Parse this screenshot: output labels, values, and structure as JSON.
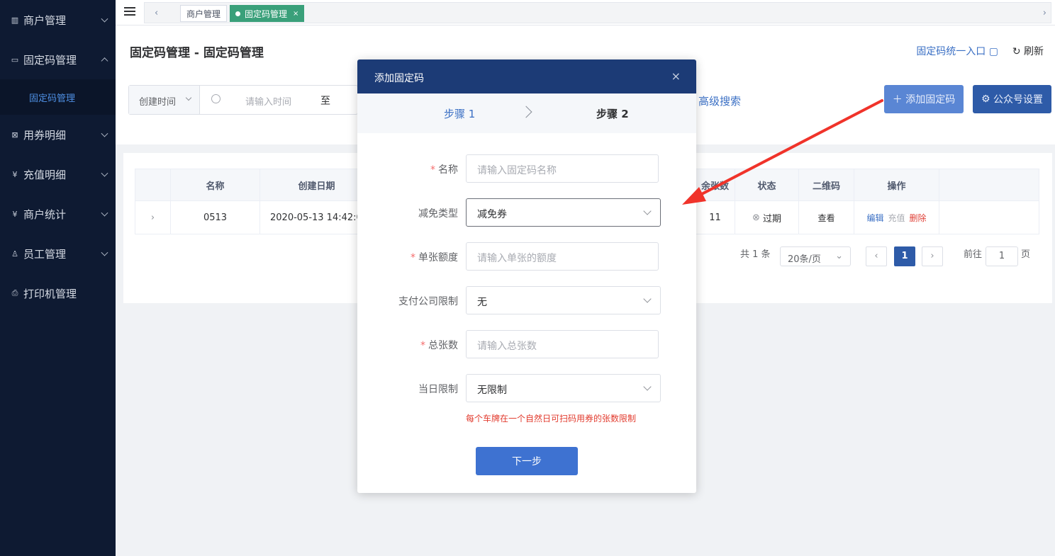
{
  "sidebar": {
    "items": [
      {
        "label": "商户管理",
        "icon": "building-icon"
      },
      {
        "label": "固定码管理",
        "icon": "card-icon"
      },
      {
        "label": "用券明细",
        "icon": "coupon-icon"
      },
      {
        "label": "充值明细",
        "icon": "yen-icon"
      },
      {
        "label": "商户统计",
        "icon": "yen-icon"
      },
      {
        "label": "员工管理",
        "icon": "user-icon"
      },
      {
        "label": "打印机管理",
        "icon": "printer-icon"
      }
    ],
    "sub_item": "固定码管理"
  },
  "tabs": {
    "tab1": "商户管理",
    "tab2": "固定码管理",
    "close": "×"
  },
  "header": {
    "title": "固定码管理 - 固定码管理",
    "entry_link": "固定码统一入口",
    "refresh": "刷新"
  },
  "filter": {
    "select": "创建时间",
    "placeholder": "请输入时间",
    "to": "至",
    "advanced": "高级搜索"
  },
  "buttons": {
    "add": "添加固定码",
    "wechat": "公众号设置"
  },
  "table": {
    "headers": [
      "名称",
      "创建日期",
      "余张数",
      "状态",
      "二维码",
      "操作"
    ],
    "row": {
      "name": "0513",
      "date": "2020-05-13 14:42:0",
      "remain": "11",
      "status": "过期",
      "qr": "查看",
      "edit": "编辑",
      "recharge": "充值",
      "delete": "删除"
    }
  },
  "pager": {
    "total": "共 1 条",
    "size": "20条/页",
    "page": "1",
    "goto": "前往",
    "goto_page": "1",
    "page_unit": "页"
  },
  "dialog": {
    "title": "添加固定码",
    "close": "×",
    "step1": "步骤 1",
    "step2": "步骤 2",
    "fields": {
      "name_label": "名称",
      "name_ph": "请输入固定码名称",
      "type_label": "减免类型",
      "type_value": "减免券",
      "amount_label": "单张额度",
      "amount_ph": "请输入单张的额度",
      "pay_label": "支付公司限制",
      "pay_value": "无",
      "total_label": "总张数",
      "total_ph": "请输入总张数",
      "daily_label": "当日限制",
      "daily_value": "无限制"
    },
    "hint": "每个车牌在一个自然日可扫码用券的张数限制",
    "next": "下一步"
  },
  "colors": {
    "sidebar_bg": "#0e1a32",
    "dialog_header": "#1c3b76",
    "primary": "#3e72d1",
    "annotation_arrow": "#f0332a"
  }
}
